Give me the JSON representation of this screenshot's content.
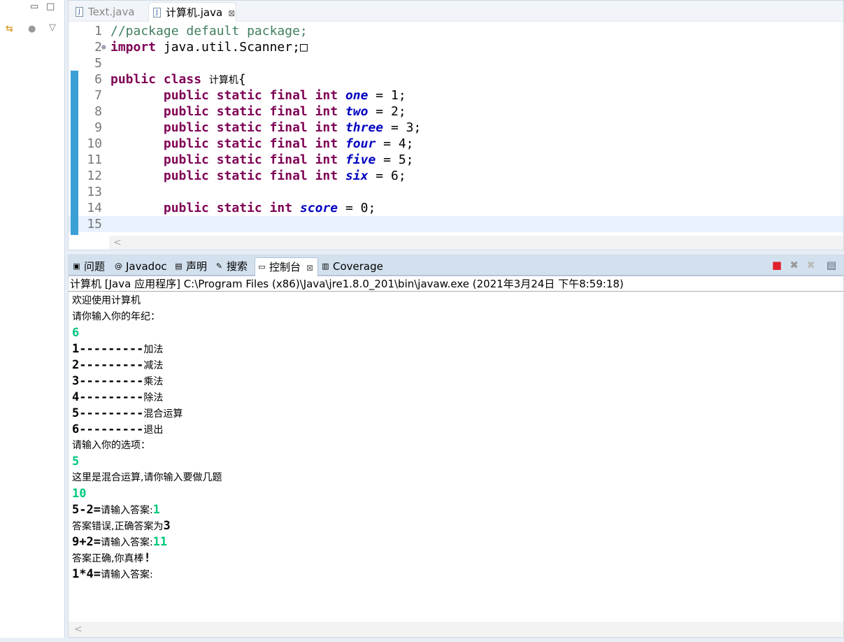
{
  "editor": {
    "tabs": [
      {
        "label": "Text.java"
      },
      {
        "label": "计算机.java",
        "active": true
      }
    ],
    "lines": [
      {
        "n": "1",
        "seg": [
          [
            "cm",
            "//package default package;"
          ]
        ]
      },
      {
        "n": "2",
        "fold": "⊕",
        "seg": [
          [
            "kw",
            "import"
          ],
          [
            "",
            "java.util.Scanner;"
          ],
          [
            "",
            "□"
          ]
        ]
      },
      {
        "n": "5",
        "seg": []
      },
      {
        "n": "6",
        "seg": [
          [
            "kw",
            "public class "
          ],
          [
            "cn",
            "计算机"
          ],
          [
            "",
            "{"
          ]
        ]
      },
      {
        "n": "7",
        "seg": [
          [
            "",
            "       "
          ],
          [
            "kw",
            "public static final int "
          ],
          [
            "fd",
            "one"
          ],
          [
            "",
            " = 1;"
          ]
        ]
      },
      {
        "n": "8",
        "seg": [
          [
            "",
            "       "
          ],
          [
            "kw",
            "public static final int "
          ],
          [
            "fd",
            "two"
          ],
          [
            "",
            " = 2;"
          ]
        ]
      },
      {
        "n": "9",
        "seg": [
          [
            "",
            "       "
          ],
          [
            "kw",
            "public static final int "
          ],
          [
            "fd",
            "three"
          ],
          [
            "",
            " = 3;"
          ]
        ]
      },
      {
        "n": "10",
        "seg": [
          [
            "",
            "       "
          ],
          [
            "kw",
            "public static final int "
          ],
          [
            "fd",
            "four"
          ],
          [
            "",
            " = 4;"
          ]
        ]
      },
      {
        "n": "11",
        "seg": [
          [
            "",
            "       "
          ],
          [
            "kw",
            "public static final int "
          ],
          [
            "fd",
            "five"
          ],
          [
            "",
            " = 5;"
          ]
        ]
      },
      {
        "n": "12",
        "seg": [
          [
            "",
            "       "
          ],
          [
            "kw",
            "public static final int "
          ],
          [
            "fd",
            "six"
          ],
          [
            "",
            " = 6;"
          ]
        ]
      },
      {
        "n": "13",
        "seg": []
      },
      {
        "n": "14",
        "seg": [
          [
            "",
            "       "
          ],
          [
            "kw",
            "public static int "
          ],
          [
            "fd",
            "score"
          ],
          [
            "",
            " = 0;"
          ]
        ]
      },
      {
        "n": "15",
        "cur": true,
        "seg": []
      }
    ]
  },
  "console": {
    "tabs": [
      {
        "label": "问题",
        "icon": "problems-icon"
      },
      {
        "label": "Javadoc",
        "icon": "at-icon"
      },
      {
        "label": "声明",
        "icon": "declaration-icon"
      },
      {
        "label": "搜索",
        "icon": "search-icon"
      },
      {
        "label": "控制台",
        "icon": "console-icon",
        "active": true
      },
      {
        "label": "Coverage",
        "icon": "coverage-icon"
      }
    ],
    "header": "计算机 [Java 应用程序] C:\\Program Files (x86)\\Java\\jre1.8.0_201\\bin\\javaw.exe  (2021年3月24日 下午8:59:18)",
    "lines": [
      [
        [
          "t",
          "欢迎使用计算机"
        ]
      ],
      [
        [
          "t",
          "请你输入你的年纪："
        ]
      ],
      [
        [
          "in",
          "6"
        ]
      ],
      [
        [
          "m",
          "1---------"
        ],
        [
          "t",
          "加法"
        ]
      ],
      [
        [
          "m",
          "2---------"
        ],
        [
          "t",
          "减法"
        ]
      ],
      [
        [
          "m",
          "3---------"
        ],
        [
          "t",
          "乘法"
        ]
      ],
      [
        [
          "m",
          "4---------"
        ],
        [
          "t",
          "除法"
        ]
      ],
      [
        [
          "m",
          "5---------"
        ],
        [
          "t",
          "混合运算"
        ]
      ],
      [
        [
          "m",
          "6---------"
        ],
        [
          "t",
          "退出"
        ]
      ],
      [
        [
          "t",
          "请输入你的选项："
        ]
      ],
      [
        [
          "in",
          "5"
        ]
      ],
      [
        [
          "t",
          "这里是混合运算,请你输入要做几题"
        ]
      ],
      [
        [
          "in",
          "10"
        ]
      ],
      [
        [
          "m",
          "5-2="
        ],
        [
          "t",
          "请输入答案:"
        ],
        [
          "in",
          "1"
        ]
      ],
      [
        [
          "t",
          "答案错误,正确答案为"
        ],
        [
          "m",
          "3"
        ]
      ],
      [
        [
          "m",
          "9+2="
        ],
        [
          "t",
          "请输入答案:"
        ],
        [
          "in",
          "11"
        ]
      ],
      [
        [
          "t",
          "答案正确,你真棒"
        ],
        [
          "m",
          "!"
        ]
      ],
      [
        [
          "m",
          "1*4="
        ],
        [
          "t",
          "请输入答案:"
        ]
      ]
    ]
  },
  "colors": {
    "keyword": "#7f0055",
    "comment": "#3f7f5f",
    "field": "#0000c0",
    "input": "#00c87d",
    "ruler": "#3c9fd6"
  }
}
